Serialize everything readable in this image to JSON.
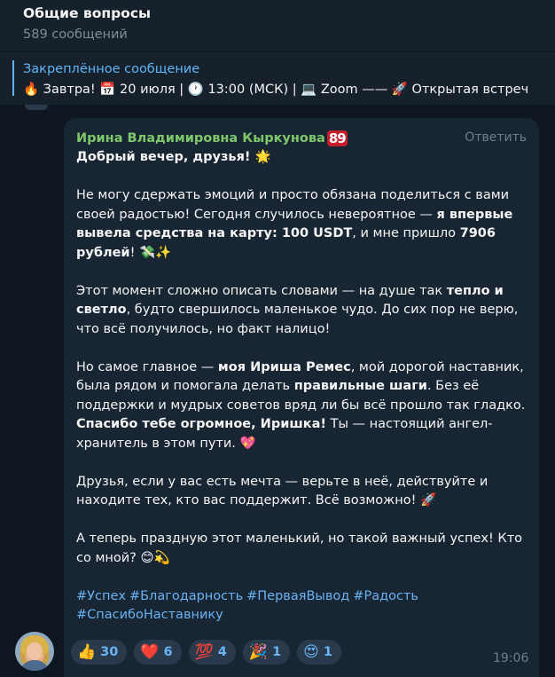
{
  "header": {
    "title": "Общие вопросы",
    "subtitle": "589 сообщений"
  },
  "pinned": {
    "label": "Закреплённое сообщение",
    "text": "🔥 Завтра! 📅 20 июля | 🕐 13:00 (МСК) | 💻 Zoom —— 🚀 Открытая встреч"
  },
  "message": {
    "author": "Ирина Владимировна Кыркунова",
    "author_badge": "89",
    "reply_label": "Ответить",
    "greeting": "Добрый вечер, друзья! 🌟",
    "p1_a": "Не могу сдержать эмоций и просто обязана поделиться с вами своей радостью! Сегодня случилось невероятное — ",
    "p1_b": "я впервые вывела средства на карту: 100 USDT",
    "p1_c": ", и мне пришло ",
    "p1_d": "7906 рублей",
    "p1_e": "! 💸✨",
    "p2_a": "Этот момент сложно описать словами — на душе так ",
    "p2_b": "тепло и светло",
    "p2_c": ", будто свершилось маленькое чудо. До сих пор не верю, что всё получилось, но факт налицо!",
    "p3_a": "Но самое главное — ",
    "p3_b": "моя Ириша Ремес",
    "p3_c": ", мой дорогой наставник, была рядом и помогала делать ",
    "p3_d": "правильные шаги",
    "p3_e": ". Без её поддержки и мудрых советов вряд ли бы всё прошло так гладко. ",
    "p3_f": "Спасибо тебе огромное, Иришка!",
    "p3_g": " Ты — настоящий ангел-хранитель в этом пути. 💖",
    "p4": "Друзья, если у вас есть мечта — верьте в неё, действуйте и находите тех, кто вас поддержит. Всё возможно! 🚀",
    "p5": "А теперь праздную этот маленький, но такой важный успех! Кто со мной? 😊💫",
    "hashtags": [
      "#Успех",
      "#Благодарность",
      "#ПерваяВывод",
      "#Радость",
      "#СпасибоНаставнику"
    ],
    "time": "19:06"
  },
  "reactions": [
    {
      "emoji": "👍",
      "count": "30"
    },
    {
      "emoji": "❤️",
      "count": "6"
    },
    {
      "emoji": "💯",
      "count": "4"
    },
    {
      "emoji": "🎉",
      "count": "1"
    },
    {
      "emoji": "😍",
      "count": "1"
    }
  ],
  "colors": {
    "background": "#0e1621",
    "bubble": "#182533",
    "accent": "#6ab3f3",
    "author": "#7ec86b"
  }
}
